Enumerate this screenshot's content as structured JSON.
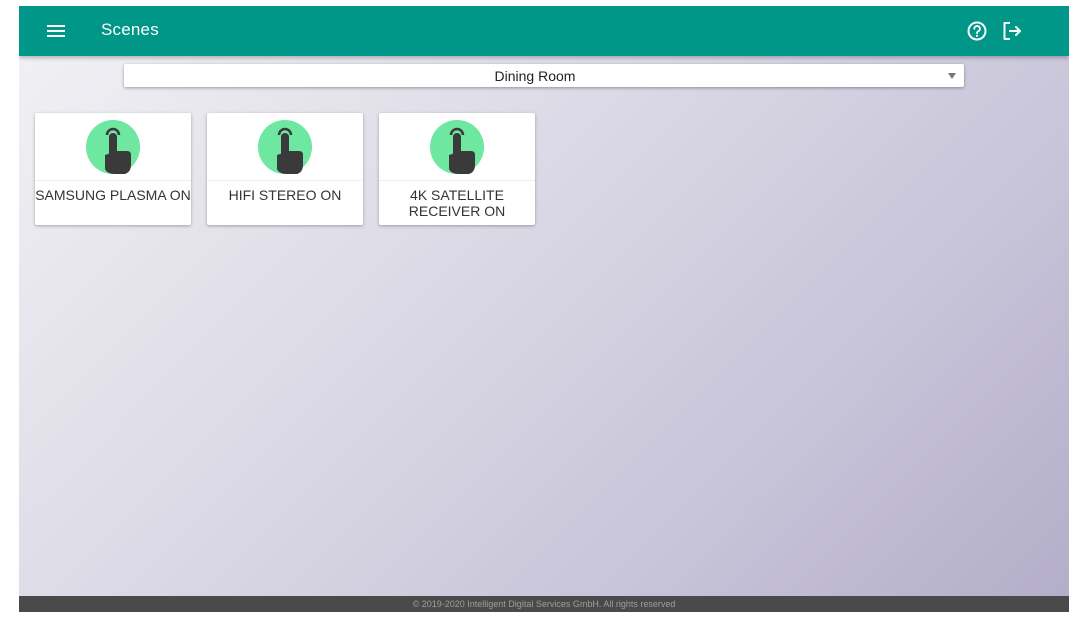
{
  "header": {
    "title": "Scenes",
    "bg_color": "#009688",
    "icons": {
      "menu": "hamburger-menu-icon",
      "help": "help-circle-icon",
      "logout": "logout-icon"
    }
  },
  "room_select": {
    "selected": "Dining Room"
  },
  "scenes": [
    {
      "label": "SAMSUNG PLASMA ON",
      "icon": "touch-hand-icon",
      "icon_color": "#6ee7a0"
    },
    {
      "label": "HIFI STEREO ON",
      "icon": "touch-hand-icon",
      "icon_color": "#6ee7a0"
    },
    {
      "label": "4K SATELLITE RECEIVER ON",
      "icon": "touch-hand-icon",
      "icon_color": "#6ee7a0"
    }
  ],
  "footer": {
    "text": "© 2019-2020 Intelligent Digital Services GmbH. All rights reserved"
  }
}
